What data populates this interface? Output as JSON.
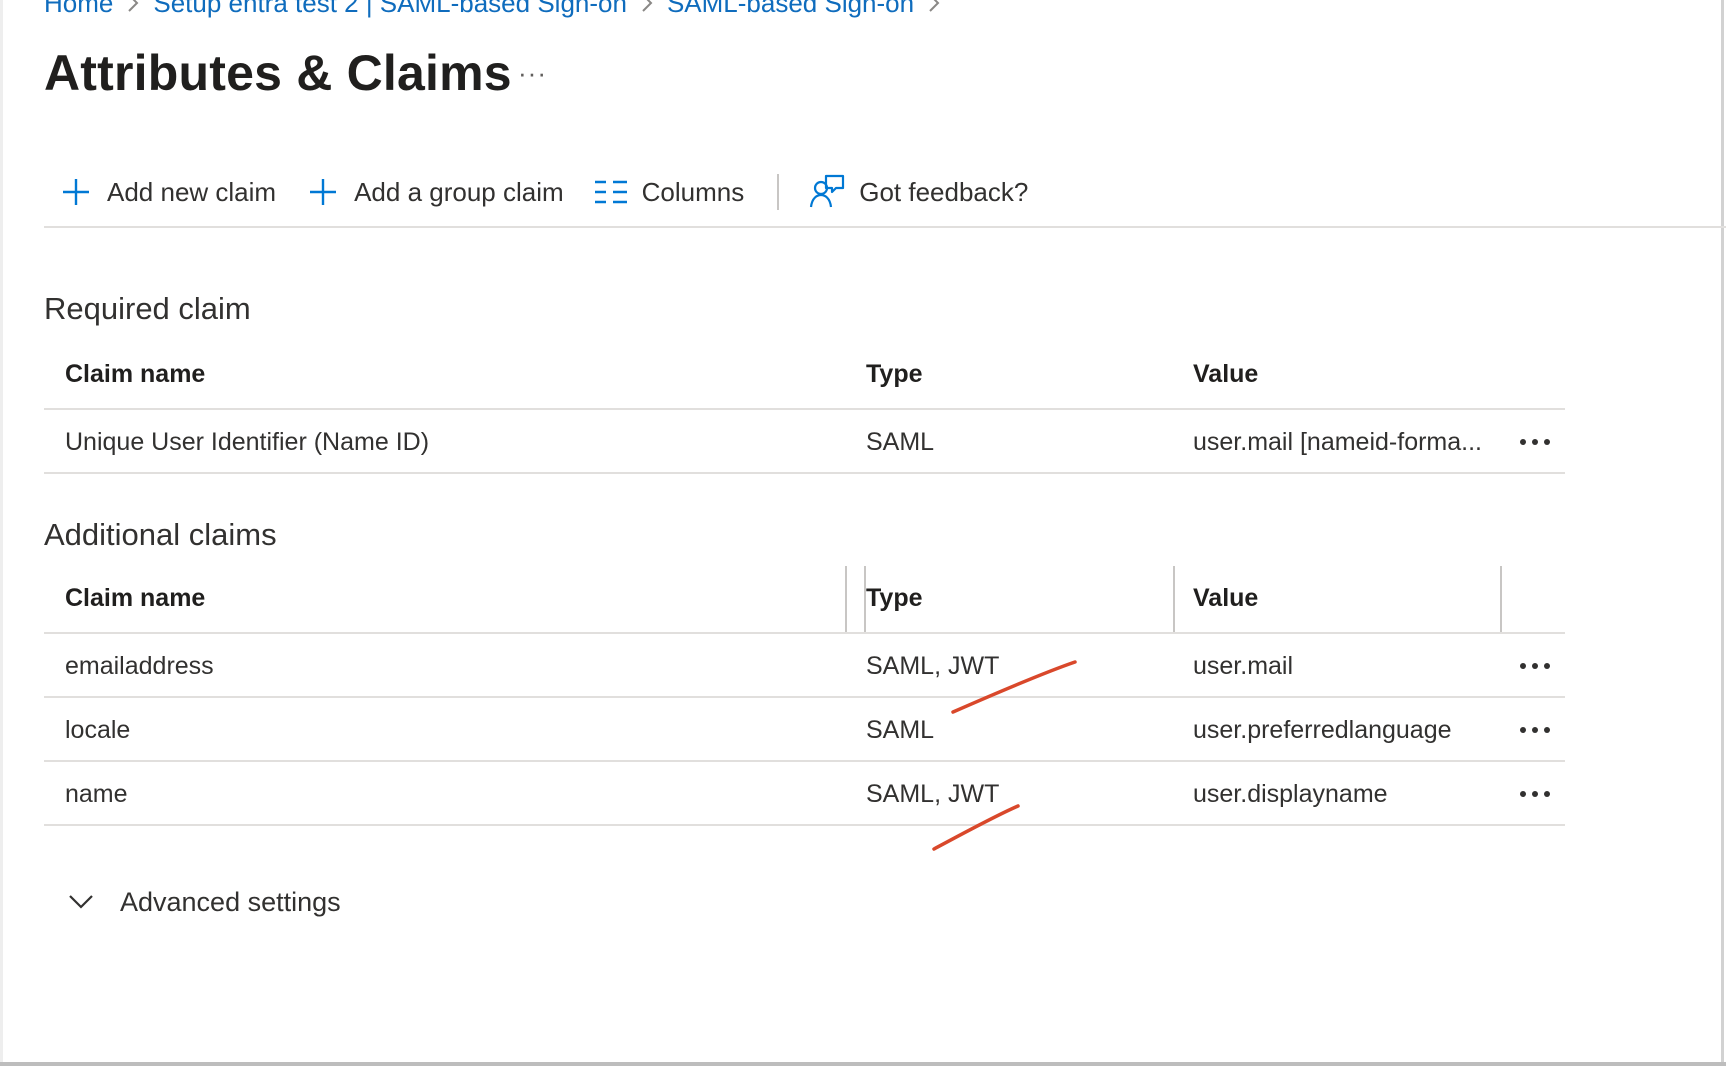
{
  "breadcrumb": [
    {
      "label": "Home"
    },
    {
      "label": "Setup entra test 2 | SAML-based Sign-on"
    },
    {
      "label": "SAML-based Sign-on"
    }
  ],
  "page": {
    "title": "Attributes & Claims",
    "more_label": "···"
  },
  "toolbar": {
    "add_new_claim": "Add new claim",
    "add_group_claim": "Add a group claim",
    "columns": "Columns",
    "feedback": "Got feedback?"
  },
  "required_section": {
    "title": "Required claim",
    "headers": {
      "name": "Claim name",
      "type": "Type",
      "value": "Value"
    },
    "rows": [
      {
        "name": "Unique User Identifier (Name ID)",
        "type": "SAML",
        "value": "user.mail [nameid-forma..."
      }
    ]
  },
  "additional_section": {
    "title": "Additional claims",
    "headers": {
      "name": "Claim name",
      "type": "Type",
      "value": "Value"
    },
    "rows": [
      {
        "name": "emailaddress",
        "type": "SAML, JWT",
        "value": "user.mail"
      },
      {
        "name": "locale",
        "type": "SAML",
        "value": "user.preferredlanguage"
      },
      {
        "name": "name",
        "type": "SAML, JWT",
        "value": "user.displayname"
      }
    ]
  },
  "advanced_settings": {
    "label": "Advanced settings"
  },
  "colors": {
    "link": "#0f6cbd",
    "accent": "#0078d4",
    "annotation": "#d9482b",
    "divider": "#e1dfdd"
  },
  "icons": {
    "add": "plus-icon",
    "columns": "columns-icon",
    "feedback": "feedback-icon",
    "more": "more-icon",
    "advanced": "chevron-down-icon"
  }
}
